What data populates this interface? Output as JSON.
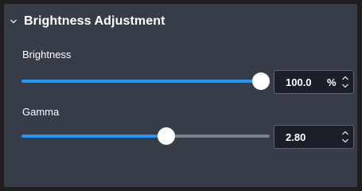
{
  "panel": {
    "title": "Brightness Adjustment",
    "collapse_icon": "chevron-down-icon"
  },
  "brightness": {
    "label": "Brightness",
    "value": "100.0",
    "unit": "%",
    "fraction": 1.0
  },
  "gamma": {
    "label": "Gamma",
    "value": "2.80",
    "fraction": 0.59
  },
  "colors": {
    "panel_bg": "#363c48",
    "accent": "#2196f3",
    "track": "#7c808a",
    "input_bg": "#1c1f28"
  }
}
